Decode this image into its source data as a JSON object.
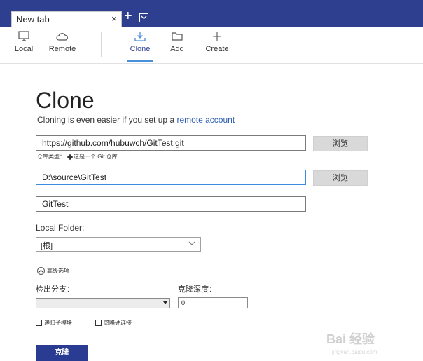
{
  "tab": {
    "title": "New tab",
    "close_glyph": "×",
    "add_glyph": "+"
  },
  "toolbar": {
    "local": "Local",
    "remote": "Remote",
    "clone": "Clone",
    "add": "Add",
    "create": "Create"
  },
  "page": {
    "title": "Clone",
    "subtitle_prefix": "Cloning is even easier if you set up a ",
    "subtitle_link": "remote account"
  },
  "form": {
    "url_value": "https://github.com/hubuwch/GitTest.git",
    "browse_label": "浏览",
    "repo_type_prefix": "仓库类型：",
    "repo_type_value": "这是一个 Git 仓库",
    "path_value": "D:\\source\\GitTest",
    "name_value": "GitTest",
    "local_folder_label": "Local Folder:",
    "local_folder_value": "[根]",
    "advanced_label": "高级选项",
    "checkout_branch_label": "检出分支：",
    "clone_depth_label": "克隆深度：",
    "clone_depth_value": "0",
    "recursive_submodules": "递归子模块",
    "ignore_hardlinks": "忽略硬连接",
    "clone_button": "克隆"
  },
  "watermark": {
    "text": "Bai 经验",
    "sub": "jingyan.baidu.com"
  },
  "colors": {
    "titlebar": "#2f3f8f",
    "primary_button": "#2a3c91",
    "link": "#2f5fb3",
    "focus_border": "#3d8be0"
  },
  "icons": [
    "monitor-icon",
    "cloud-icon",
    "download-icon",
    "folder-icon",
    "plus-icon",
    "chevron-down-icon",
    "chevron-up-icon"
  ]
}
